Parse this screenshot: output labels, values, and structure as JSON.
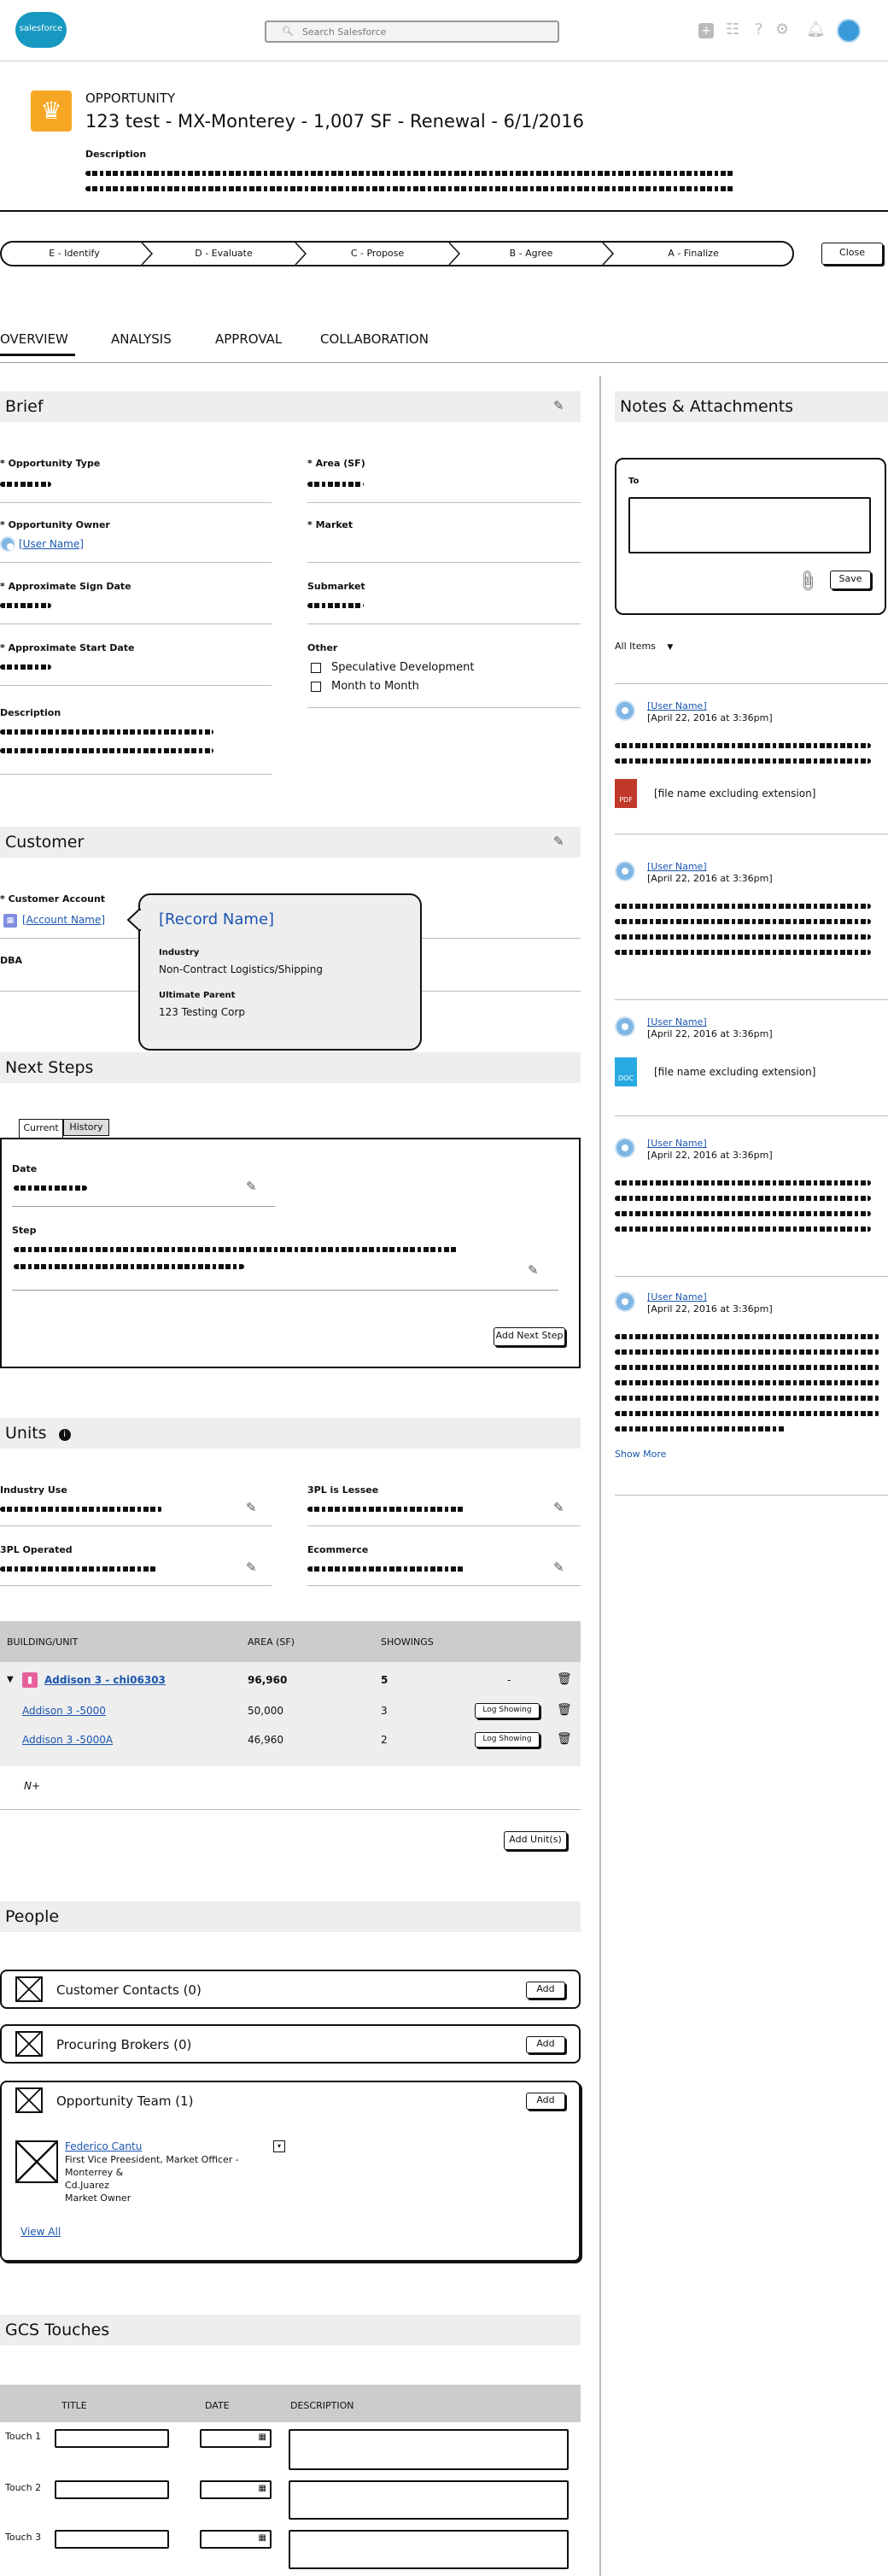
{
  "header": {
    "logo_text": "salesforce",
    "search_placeholder": "Search Salesforce",
    "icons": [
      "plus-icon",
      "apps-grid-icon",
      "help-icon",
      "setup-gear-icon",
      "notification-bell-icon",
      "user-avatar-icon"
    ]
  },
  "record": {
    "object_type": "OPPORTUNITY",
    "title": "123 test - MX-Monterey - 1,007 SF - Renewal - 6/1/2016",
    "description_label": "Description"
  },
  "path": {
    "stages": [
      "E - Identify",
      "D - Evaluate",
      "C - Propose",
      "B - Agree",
      "A - Finalize"
    ],
    "close_label": "Close"
  },
  "tabs": [
    "OVERVIEW",
    "ANALYSIS",
    "APPROVAL",
    "COLLABORATION"
  ],
  "brief": {
    "title": "Brief",
    "opportunity_type_label": "* Opportunity Type",
    "area_label": "* Area (SF)",
    "owner_label": "* Opportunity Owner",
    "owner_value": "[User Name]",
    "market_label": "* Market",
    "sign_date_label": "* Approximate Sign Date",
    "submarket_label": "Submarket",
    "start_date_label": "* Approximate Start Date",
    "other_label": "Other",
    "checkbox_1": "Speculative Development",
    "checkbox_2": "Month to Month",
    "description_label": "Description"
  },
  "customer": {
    "title": "Customer",
    "account_label": "* Customer Account",
    "account_value": "[Account Name]",
    "dba_label": "DBA",
    "popover": {
      "record_name": "[Record Name]",
      "industry_label": "Industry",
      "industry_value": "Non-Contract Logistics/Shipping",
      "parent_label": "Ultimate Parent",
      "parent_value": "123 Testing Corp"
    }
  },
  "next_steps": {
    "title": "Next Steps",
    "tab_current": "Current",
    "tab_history": "History",
    "date_label": "Date",
    "step_label": "Step",
    "add_button": "Add Next Step"
  },
  "units": {
    "title": "Units",
    "industry_use_label": "Industry Use",
    "tpl_lessee_label": "3PL is Lessee",
    "tpl_operated_label": "3PL Operated",
    "ecommerce_label": "Ecommerce",
    "table_headers": [
      "BUILDING/UNIT",
      "AREA (SF)",
      "SHOWINGS"
    ],
    "rows": [
      {
        "name": "Addison 3 - chi06303",
        "area": "96,960",
        "showings": "5",
        "extra": "-"
      },
      {
        "name": "Addison 3 -5000",
        "area": "50,000",
        "showings": "3",
        "extra": "Log Showing"
      },
      {
        "name": "Addison 3 -5000A",
        "area": "46,960",
        "showings": "2",
        "extra": "Log Showing"
      }
    ],
    "more_label": "N+",
    "add_button": "Add Unit(s)"
  },
  "people": {
    "title": "People",
    "customer_contacts": "Customer Contacts (0)",
    "procuring_brokers": "Procuring Brokers (0)",
    "opportunity_team": "Opportunity Team (1)",
    "add_label": "Add",
    "member_name": "Federico Cantu",
    "member_title_1": "First Vice Preesident, Market Officer -",
    "member_title_2": "Monterrey &",
    "member_title_3": "Cd.Juarez",
    "member_role": "Market Owner",
    "view_all": "View All"
  },
  "gcs": {
    "title": "GCS Touches",
    "headers": [
      "TITLE",
      "DATE",
      "DESCRIPTION"
    ],
    "rows": [
      "Touch 1",
      "Touch 2",
      "Touch 3"
    ]
  },
  "notes": {
    "title": "Notes & Attachments",
    "to_label": "To",
    "save_label": "Save",
    "filter_label": "All Items",
    "entries": [
      {
        "user": "[User Name]",
        "date": "[April 22, 2016 at 3:36pm]",
        "file": "[file name excluding extension]",
        "file_type": "PDF"
      },
      {
        "user": "[User Name]",
        "date": "[April 22, 2016 at 3:36pm]"
      },
      {
        "user": "[User Name]",
        "date": "[April 22, 2016 at 3:36pm]",
        "file": "[file name excluding extension]",
        "file_type": "DOC"
      },
      {
        "user": "[User Name]",
        "date": "[April 22, 2016 at 3:36pm]"
      },
      {
        "user": "[User Name]",
        "date": "[April 22, 2016 at 3:36pm]"
      }
    ],
    "show_more": "Show More"
  },
  "colors": {
    "accent": "#f5a623",
    "link": "#1a56b0",
    "brand": "#1798c1"
  }
}
